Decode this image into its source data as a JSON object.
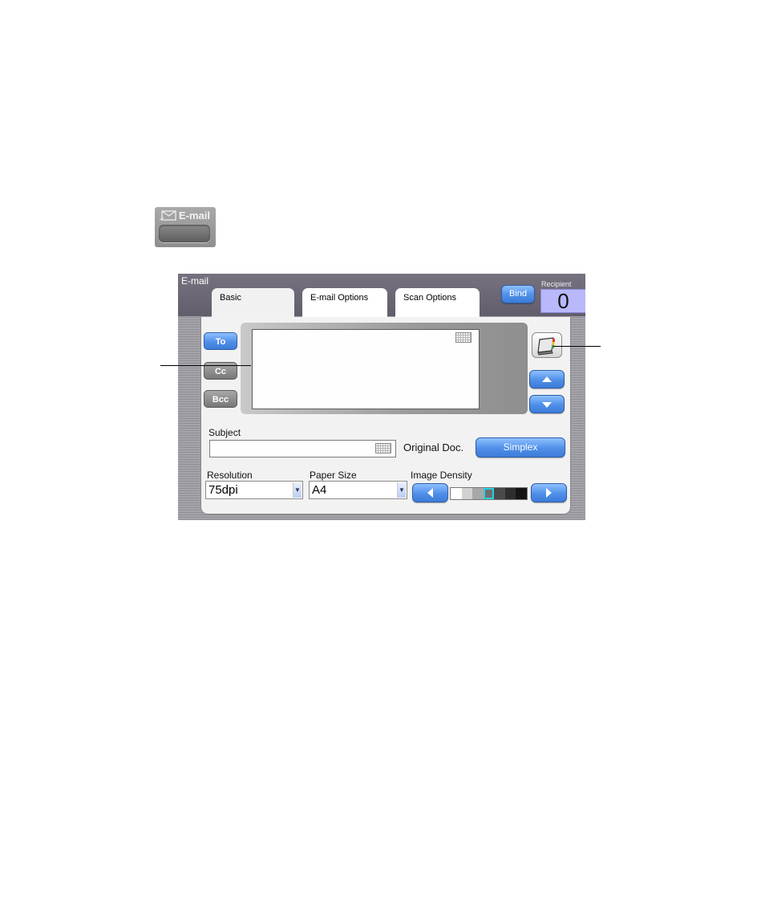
{
  "email_key": {
    "label": "E-mail",
    "icon": "envelope-icon"
  },
  "panel": {
    "title": "E-mail",
    "tabs": [
      {
        "label": "Basic",
        "selected": true
      },
      {
        "label": "E-mail Options",
        "selected": false
      },
      {
        "label": "Scan Options",
        "selected": false
      }
    ],
    "bind_label": "Bind",
    "recipient_label": "Recipient",
    "recipient_count": "0"
  },
  "address": {
    "to_label": "To",
    "cc_label": "Cc",
    "bcc_label": "Bcc",
    "value": "",
    "addressbook_icon": "address-book-icon",
    "scroll_up_icon": "arrow-up-icon",
    "scroll_down_icon": "arrow-down-icon"
  },
  "subject": {
    "label": "Subject",
    "value": ""
  },
  "original_doc": {
    "label": "Original Doc.",
    "value": "Simplex"
  },
  "resolution": {
    "label": "Resolution",
    "value": "75dpi"
  },
  "paper_size": {
    "label": "Paper Size",
    "value": "A4"
  },
  "image_density": {
    "label": "Image Density",
    "levels": [
      "#ffffff",
      "#d2d2d2",
      "#a8a8a8",
      "#6e6e6e",
      "#4a4a4a",
      "#2e2e2e",
      "#151515"
    ],
    "selected_index": 3
  },
  "colors": {
    "accent_blue": "#4f8fe8",
    "recipient_bg": "#b9b8fb",
    "header_bg": "#6b6675"
  }
}
